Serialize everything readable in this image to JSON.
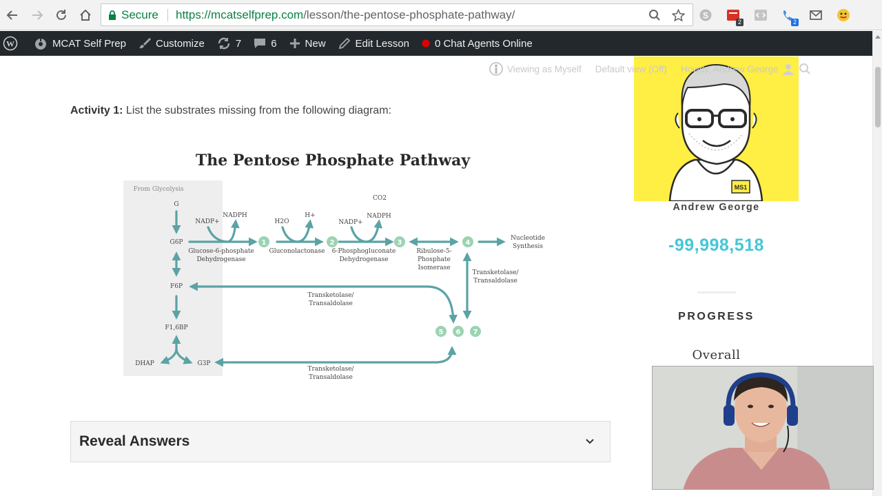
{
  "browser": {
    "secure_label": "Secure",
    "url_scheme": "https://",
    "url_host": "mcatselfprep.com",
    "url_path": "/lesson/the-pentose-phosphate-pathway/",
    "extensions": [
      {
        "name": "skype-icon",
        "badge": ""
      },
      {
        "name": "ext-red-icon",
        "badge": "2"
      },
      {
        "name": "code-icon",
        "badge": ""
      },
      {
        "name": "phone-icon",
        "badge": "2"
      },
      {
        "name": "mail-icon",
        "badge": ""
      },
      {
        "name": "emoji-icon",
        "badge": ""
      }
    ]
  },
  "adminbar": {
    "site_name": "MCAT Self Prep",
    "customize": "Customize",
    "updates_count": "7",
    "comments_count": "6",
    "new_label": "New",
    "edit_label": "Edit Lesson",
    "chat_label": "0 Chat Agents Online"
  },
  "view_strip": {
    "viewing": "Viewing as Myself",
    "default_view": "Default view (Off)",
    "howdy": "Howdy, Andrew George"
  },
  "activity": {
    "label": "Activity 1:",
    "text": "List the substrates missing from the following diagram:"
  },
  "diagram": {
    "title": "The Pentose Phosphate Pathway",
    "from_glycolysis": "From Glycolysis",
    "g": "G",
    "g6p": "G6P",
    "f6p": "F6P",
    "f16bp": "F1,6BP",
    "dhap": "DHAP",
    "g3p": "G3P",
    "nadp1": "NADP+",
    "nadph1": "NADPH",
    "h2o": "H2O",
    "hplus": "H+",
    "nadp2": "NADP+",
    "co2": "CO2",
    "nadph2": "NADPH",
    "enzyme1a": "Glucose-6-phosphate",
    "enzyme1b": "Dehydrogenase",
    "enzyme2": "Gluconolactonase",
    "enzyme3a": "6-Phosphogluconate",
    "enzyme3b": "Dehydrogenase",
    "enzyme4a": "Ribulose-5-",
    "enzyme4b": "Phosphate",
    "enzyme4c": "Isomerase",
    "nucleotide_a": "Nucleotide",
    "nucleotide_b": "Synthesis",
    "tkta_a": "Transketolase/",
    "tkta_b": "Transaldolase",
    "nodes": [
      "1",
      "2",
      "3",
      "4",
      "5",
      "6",
      "7"
    ]
  },
  "reveal": {
    "title": "Reveal Answers"
  },
  "sidebar": {
    "badge": "MS1",
    "name": "Andrew George",
    "points": "-99,998,518",
    "progress_heading": "PROGRESS",
    "overall": "Overall"
  },
  "colors": {
    "teal": "#5ba3a4",
    "node": "#9bd3b3",
    "points": "#44c6d8",
    "avatar_bg": "#ffee44",
    "adminbar": "#23282d"
  }
}
